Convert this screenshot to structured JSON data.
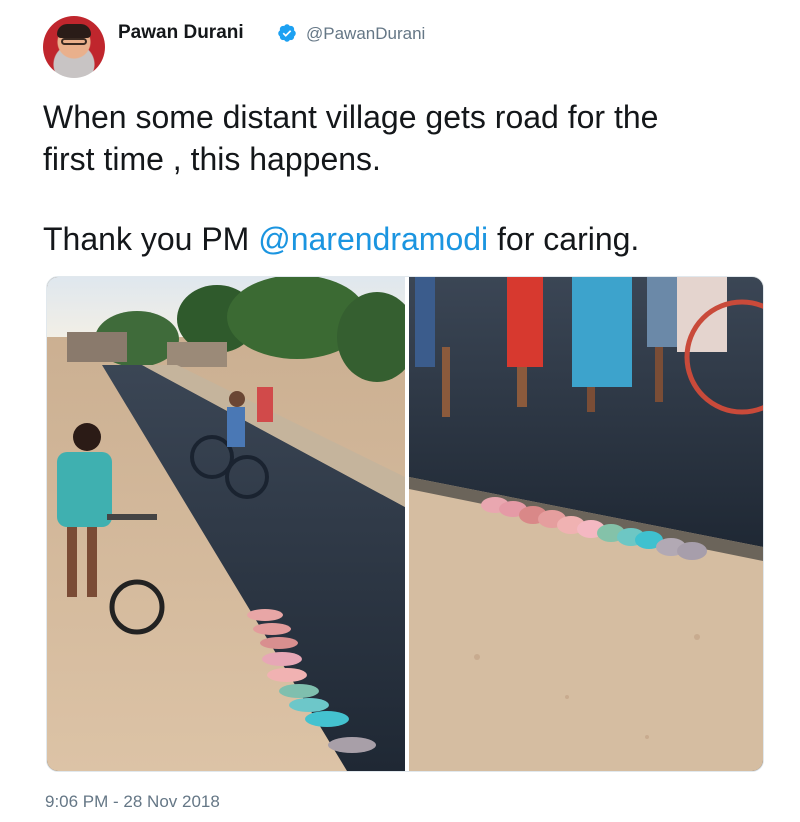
{
  "author": {
    "name": "Pawan Durani",
    "handle": "@PawanDurani",
    "verified": true
  },
  "tweet": {
    "line1": "When some distant village gets road for the",
    "line2": "first time , this happens.",
    "line3_prefix": "Thank you PM ",
    "mention": "@narendramodi",
    "line3_suffix": " for caring."
  },
  "timestamp": "9:06 PM - 28 Nov 2018",
  "colors": {
    "link": "#1b95e0",
    "secondary_text": "#657786",
    "verified": "#1da1f2"
  },
  "icons": {
    "verified": "verified-badge-icon"
  }
}
